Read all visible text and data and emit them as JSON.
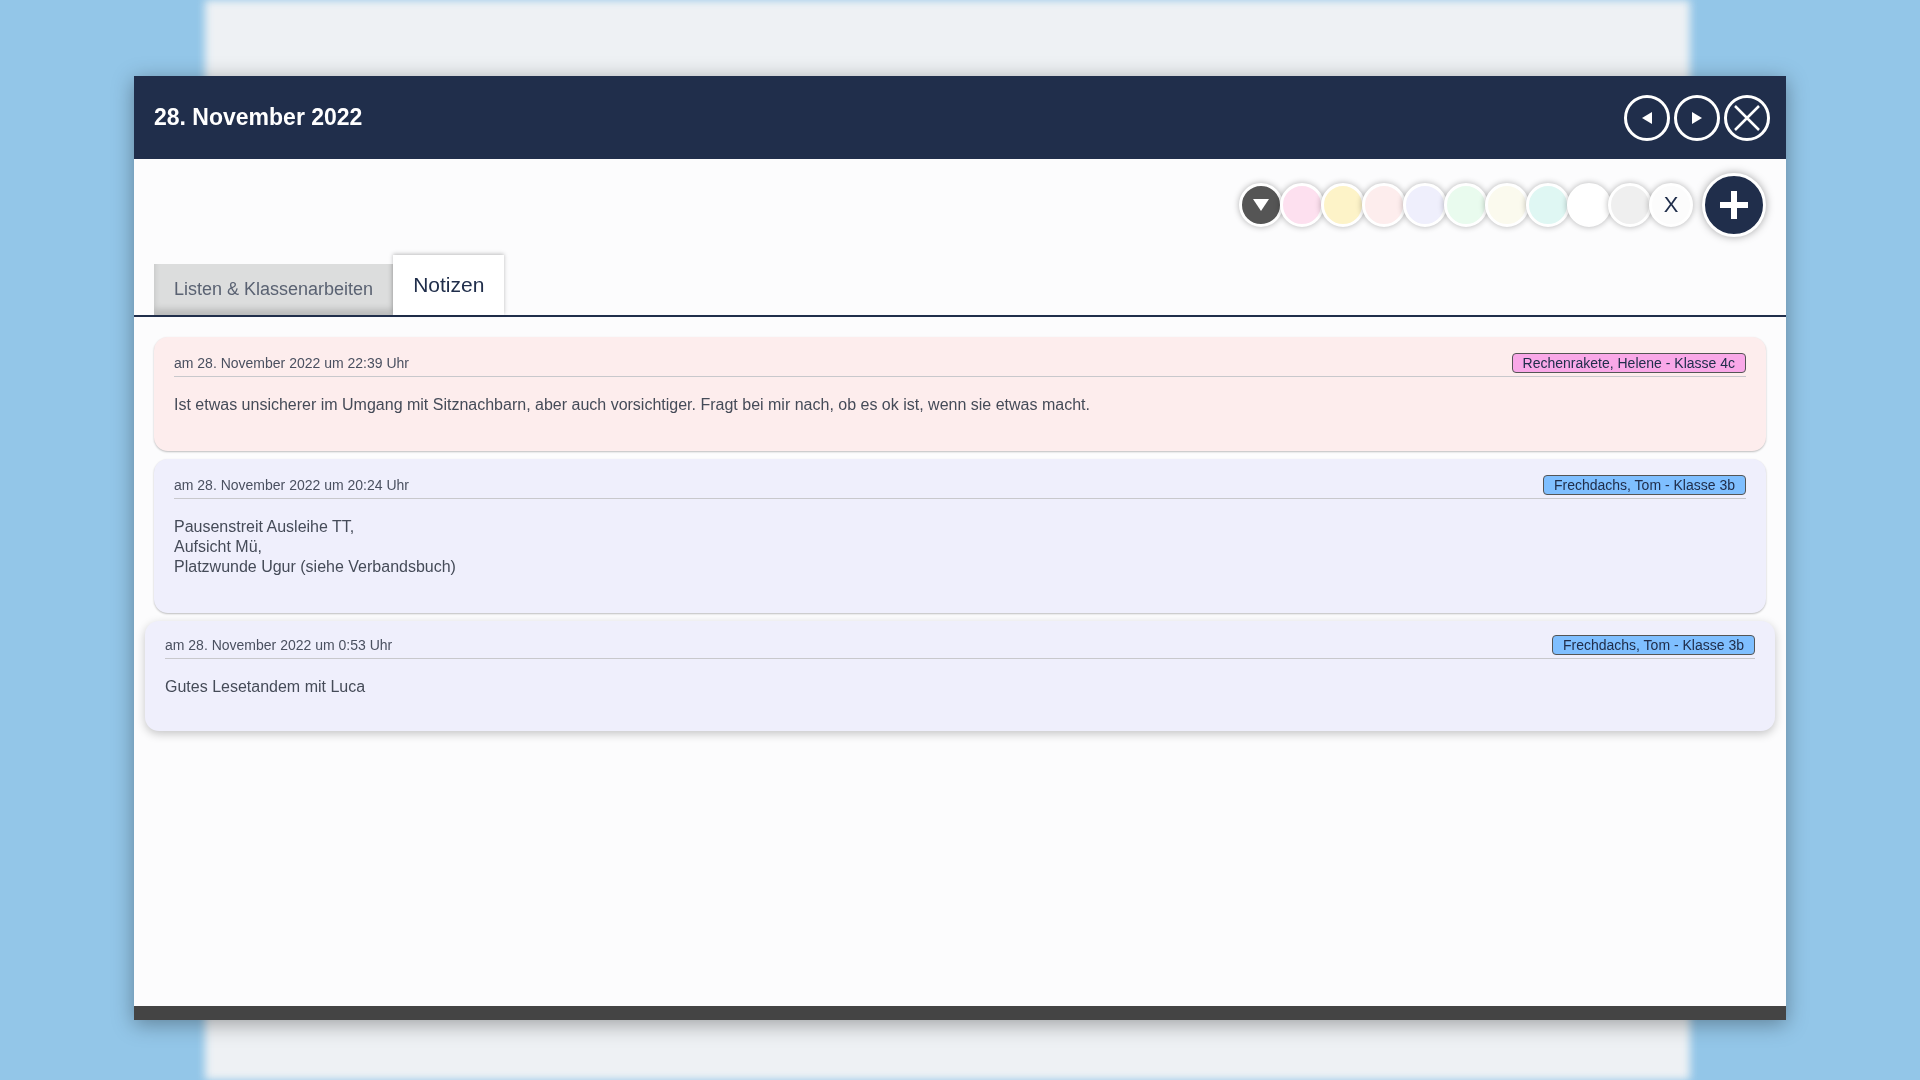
{
  "dialog": {
    "title": "28. November 2022"
  },
  "color_filter": {
    "swatches": [
      {
        "color": "#fde0ef"
      },
      {
        "color": "#fdf3c8"
      },
      {
        "color": "#fdeded"
      },
      {
        "color": "#efeffc"
      },
      {
        "color": "#e9fbee"
      },
      {
        "color": "#fbfaee"
      },
      {
        "color": "#dff7f3"
      },
      {
        "color": "#ffffff"
      },
      {
        "color": "#efefef"
      }
    ],
    "clear_label": "X"
  },
  "tabs": [
    {
      "label": "Listen & Klassenarbeiten",
      "selected": false
    },
    {
      "label": "Notizen",
      "selected": true
    }
  ],
  "notes": [
    {
      "date": "am 28. November 2022 um 22:39 Uhr",
      "tag": {
        "label": "Rechenrakete, Helene - Klasse 4c",
        "color": "#f9a8e8"
      },
      "color": "#fdeded",
      "text": "Ist etwas unsicherer im Umgang mit Sitznachbarn, aber auch vorsichtiger. Fragt bei mir nach, ob es ok ist, wenn sie etwas macht.",
      "hovered": false
    },
    {
      "date": "am 28. November 2022 um 20:24 Uhr",
      "tag": {
        "label": "Frechdachs, Tom - Klasse 3b",
        "color": "#7fbfff"
      },
      "color": "#efeffc",
      "text": "Pausenstreit Ausleihe TT,\nAufsicht Mü,\nPlatzwunde Ugur (siehe Verbandsbuch)",
      "hovered": false
    },
    {
      "date": "am 28. November 2022 um 0:53 Uhr",
      "tag": {
        "label": "Frechdachs, Tom - Klasse 3b",
        "color": "#7fbfff"
      },
      "color": "#efeffc",
      "text": "Gutes Lesetandem mit Luca",
      "hovered": true
    }
  ]
}
